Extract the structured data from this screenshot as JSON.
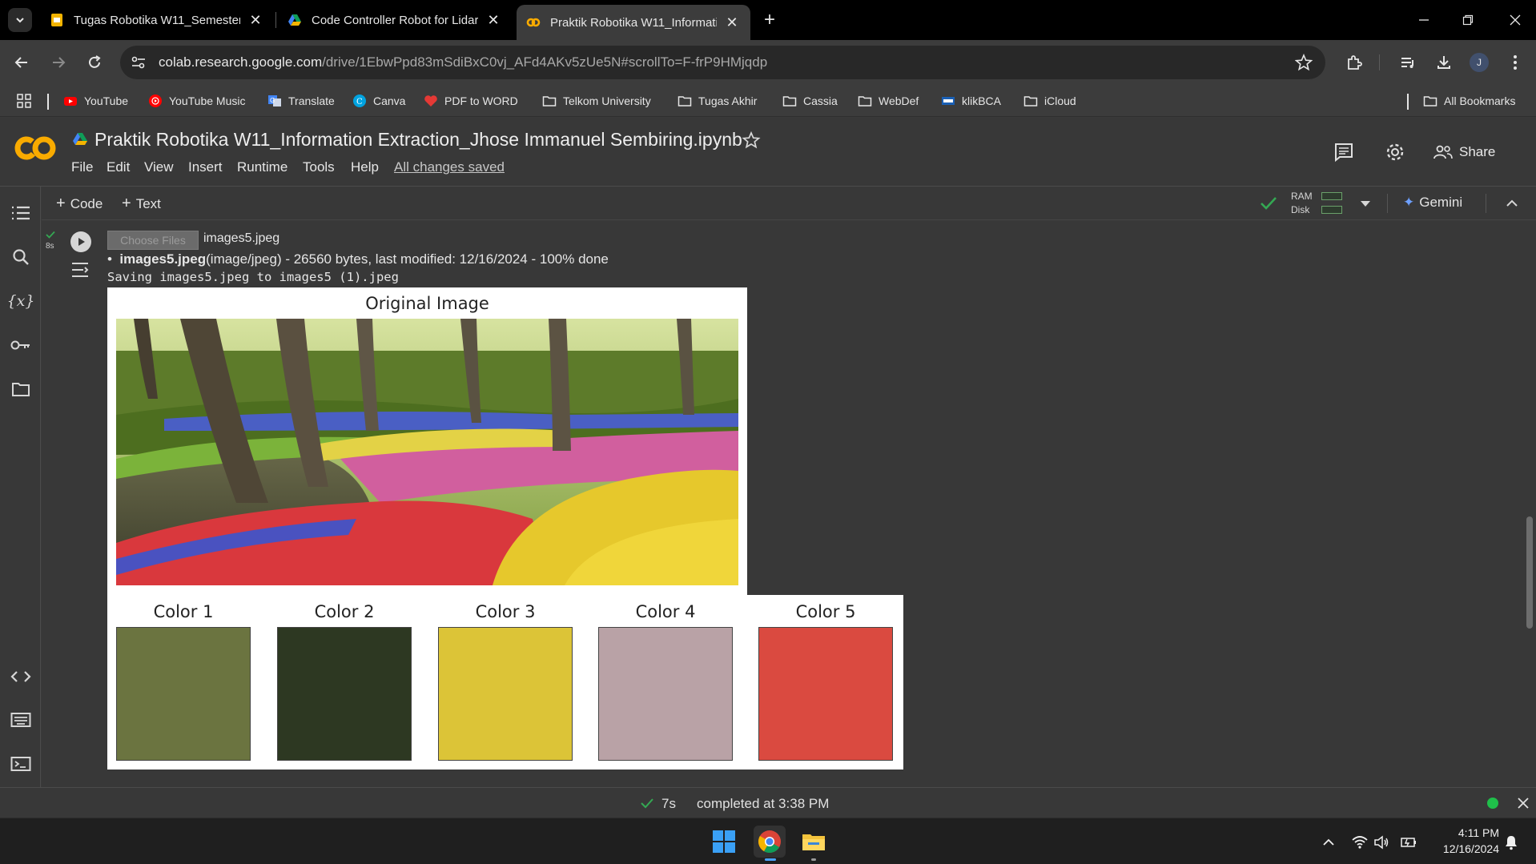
{
  "browser": {
    "tabs": [
      {
        "title": "Tugas Robotika W11_Semester",
        "icon": "google-slides-icon",
        "active": false
      },
      {
        "title": "Code Controller Robot for Lidar",
        "icon": "google-drive-icon",
        "active": false
      },
      {
        "title": "Praktik Robotika W11_Informati",
        "icon": "colab-icon",
        "active": true
      }
    ],
    "url_host": "colab.research.google.com",
    "url_path": "/drive/1EbwPpd83mSdiBxC0vj_AFd4AKv5zUe5N#scrollTo=F-frP9HMjqdp",
    "avatar_letter": "J",
    "bookmarks": [
      {
        "label": "YouTube",
        "icon": "youtube-icon"
      },
      {
        "label": "YouTube Music",
        "icon": "youtube-music-icon"
      },
      {
        "label": "Translate",
        "icon": "translate-icon"
      },
      {
        "label": "Canva",
        "icon": "canva-icon"
      },
      {
        "label": "PDF to WORD",
        "icon": "pdf-heart-icon"
      },
      {
        "label": "Telkom University",
        "icon": "folder-icon"
      },
      {
        "label": "Tugas Akhir",
        "icon": "folder-icon"
      },
      {
        "label": "Cassia",
        "icon": "folder-icon"
      },
      {
        "label": "WebDef",
        "icon": "folder-icon"
      },
      {
        "label": "klikBCA",
        "icon": "klikbca-icon"
      },
      {
        "label": "iCloud",
        "icon": "folder-icon"
      }
    ],
    "all_bookmarks": "All Bookmarks"
  },
  "colab": {
    "logo": "CO",
    "title": "Praktik Robotika W11_Information Extraction_Jhose Immanuel Sembiring.ipynb",
    "menu": [
      "File",
      "Edit",
      "View",
      "Insert",
      "Runtime",
      "Tools",
      "Help"
    ],
    "saved_status": "All changes saved",
    "share_label": "Share",
    "add_code": "Code",
    "add_text": "Text",
    "ram_label": "RAM",
    "disk_label": "Disk",
    "gemini_label": "Gemini"
  },
  "cell": {
    "exec_time": "8s",
    "choose_files": "Choose Files",
    "chosen_file": "images5.jpeg",
    "upload_name": "images5.jpeg",
    "upload_info": "(image/jpeg) - 26560 bytes, last modified: 12/16/2024 - 100% done",
    "saving_line": "Saving images5.jpeg to images5 (1).jpeg",
    "figure_title": "Original Image",
    "swatches": [
      {
        "label": "Color 1",
        "color": "#6b7440"
      },
      {
        "label": "Color 2",
        "color": "#2d3822"
      },
      {
        "label": "Color 3",
        "color": "#dcc437"
      },
      {
        "label": "Color 4",
        "color": "#b9a2a6"
      },
      {
        "label": "Color 5",
        "color": "#da4a40"
      }
    ]
  },
  "statusbar": {
    "check_time": "7s",
    "completed": "completed at 3:38 PM"
  },
  "taskbar": {
    "time": "4:11 PM",
    "date": "12/16/2024"
  }
}
